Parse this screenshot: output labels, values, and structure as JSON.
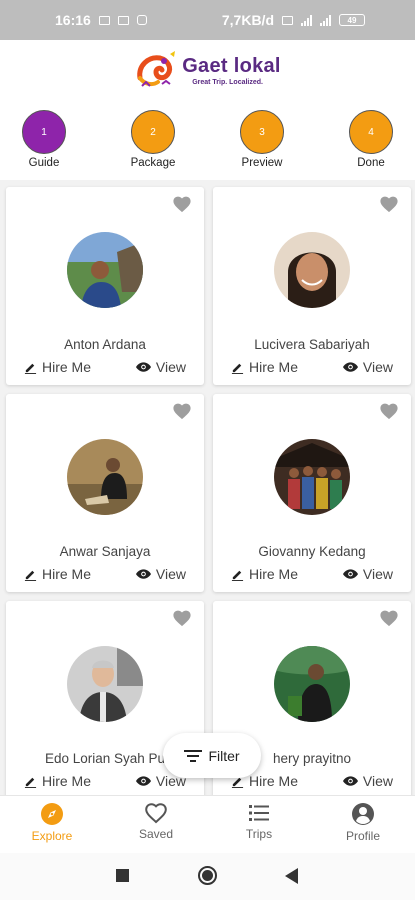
{
  "status_bar": {
    "time": "16:16",
    "speed": "7,7KB/d",
    "battery": "49"
  },
  "brand": {
    "name": "Gaet lokal",
    "tagline": "Great Trip. Localized."
  },
  "steps": [
    {
      "number": "1",
      "label": "Guide",
      "color": "#8e24aa"
    },
    {
      "number": "2",
      "label": "Package",
      "color": "#f39c12"
    },
    {
      "number": "3",
      "label": "Preview",
      "color": "#f39c12"
    },
    {
      "number": "4",
      "label": "Done",
      "color": "#f39c12"
    }
  ],
  "guides": [
    {
      "name": "Anton Ardana",
      "hire_label": "Hire Me",
      "view_label": "View"
    },
    {
      "name": "Lucivera Sabariyah",
      "hire_label": "Hire Me",
      "view_label": "View"
    },
    {
      "name": "Anwar Sanjaya",
      "hire_label": "Hire Me",
      "view_label": "View"
    },
    {
      "name": "Giovanny Kedang",
      "hire_label": "Hire Me",
      "view_label": "View"
    },
    {
      "name": "Edo Lorian Syah Pu",
      "hire_label": "Hire Me",
      "view_label": "View"
    },
    {
      "name": "hery prayitno",
      "hire_label": "Hire Me",
      "view_label": "View"
    }
  ],
  "filter": {
    "label": "Filter"
  },
  "nav": [
    {
      "label": "Explore",
      "icon": "compass-icon",
      "active": true
    },
    {
      "label": "Saved",
      "icon": "heart-outline-icon",
      "active": false
    },
    {
      "label": "Trips",
      "icon": "list-icon",
      "active": false
    },
    {
      "label": "Profile",
      "icon": "account-icon",
      "active": false
    }
  ],
  "colors": {
    "accent": "#f39c12",
    "step_active": "#8e24aa",
    "brand_purple": "#5a2a82"
  }
}
